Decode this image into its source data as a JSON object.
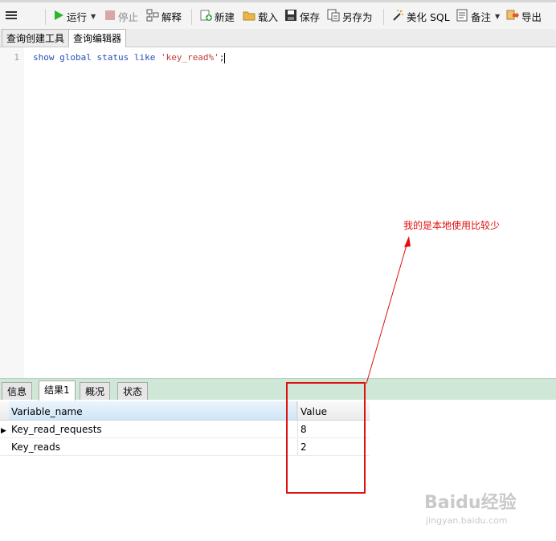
{
  "toolbar": {
    "run_label": "运行",
    "stop_label": "停止",
    "explain_label": "解释",
    "new_label": "新建",
    "load_label": "载入",
    "save_label": "保存",
    "save_as_label": "另存为",
    "beautify_label": "美化 SQL",
    "comment_label": "备注",
    "export_label": "导出"
  },
  "editor_tabs": [
    "查询创建工具",
    "查询编辑器"
  ],
  "editor": {
    "line_number": "1",
    "code_keywords": "show global status like ",
    "code_string": "'key_read%'",
    "code_end": ";"
  },
  "annotation": "我的是本地使用比较少",
  "result_tabs": [
    "信息",
    "结果1",
    "概况",
    "状态"
  ],
  "grid": {
    "columns": [
      "Variable_name",
      "Value"
    ],
    "rows": [
      {
        "name": "Key_read_requests",
        "value": "8"
      },
      {
        "name": "Key_reads",
        "value": "2"
      }
    ]
  },
  "watermark": {
    "logo": "Baidu经验",
    "url": "jingyan.baidu.com"
  },
  "colors": {
    "annotation_red": "#e01010",
    "result_tab_bar": "#cfe7d6",
    "keyword_blue": "#2a4fb5",
    "string_red": "#c43b3b"
  }
}
